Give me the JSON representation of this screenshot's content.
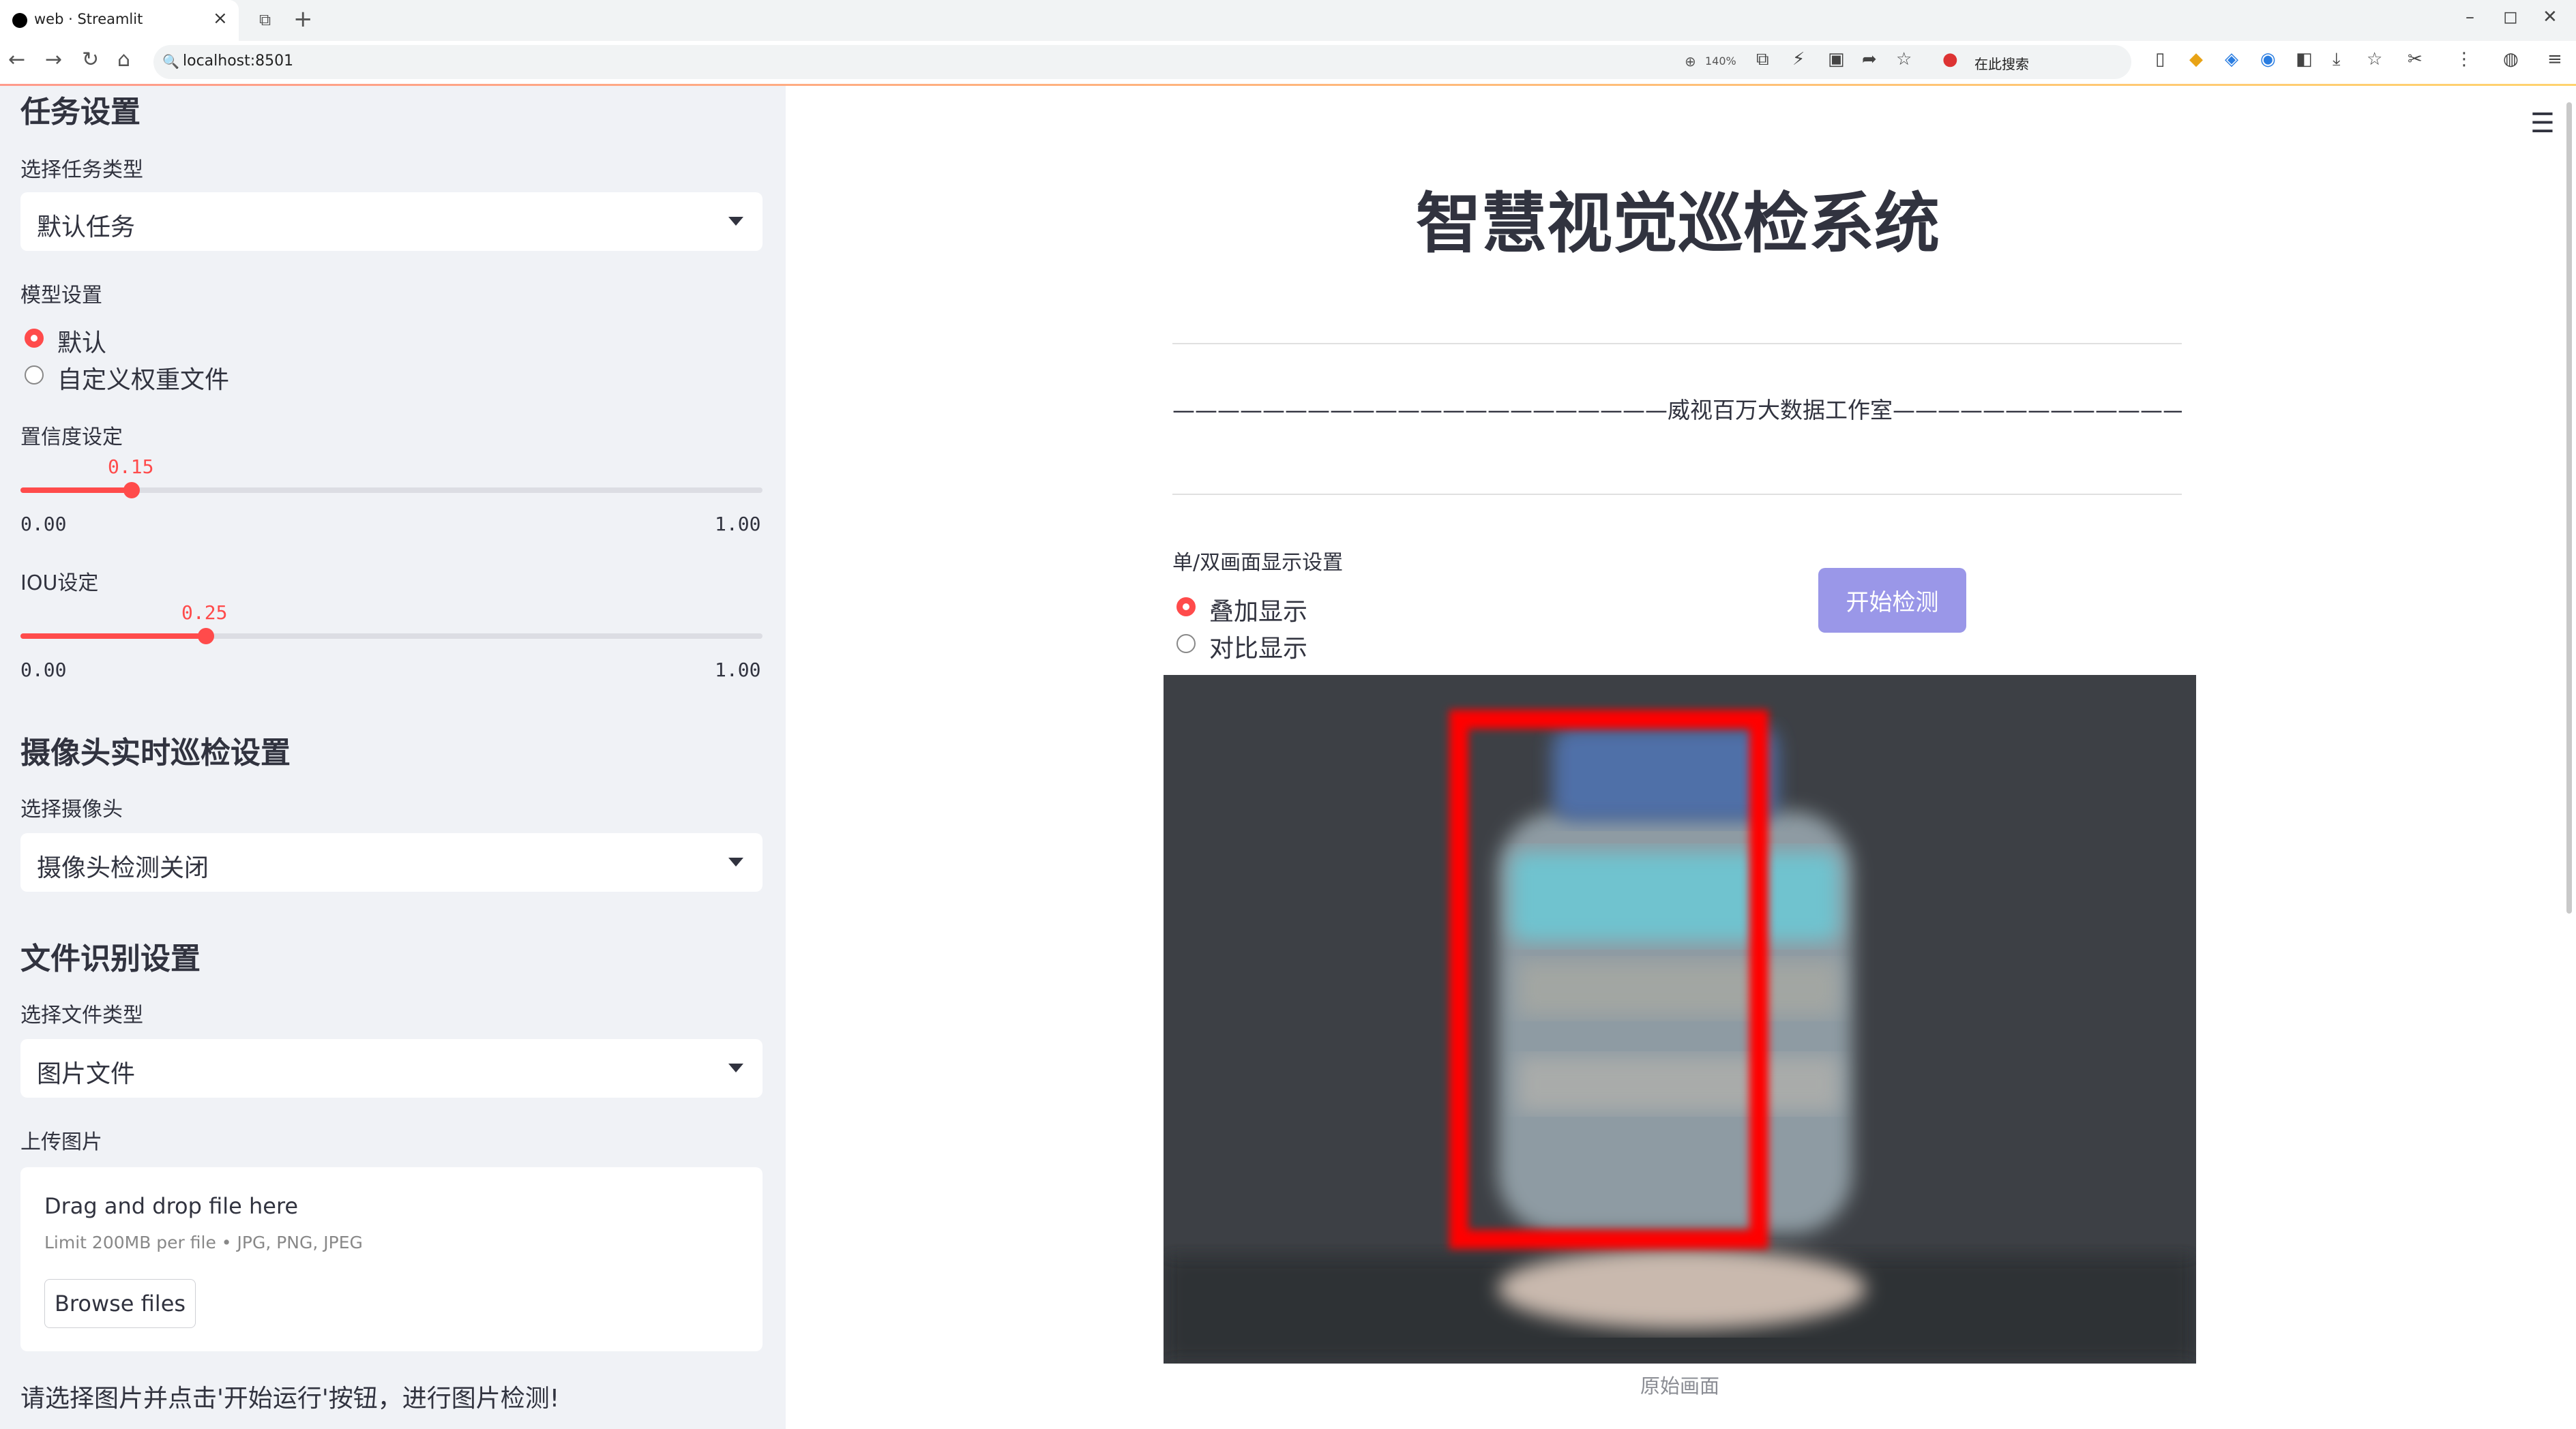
{
  "browser": {
    "tab_title": "web · Streamlit",
    "tab_close": "×",
    "new_tab": "+",
    "url": "localhost:8501",
    "zoom": "140%",
    "search_placeholder": "在此搜索",
    "window_controls": [
      "–",
      "◻",
      "✕"
    ]
  },
  "sidebar": {
    "task_section_title": "任务设置",
    "task_type_label": "选择任务类型",
    "task_type_value": "默认任务",
    "model_label": "模型设置",
    "model_options": [
      "默认",
      "自定义权重文件"
    ],
    "model_selected": 0,
    "conf_label": "置信度设定",
    "conf_value": "0.15",
    "conf_fraction": 0.15,
    "conf_min": "0.00",
    "conf_max": "1.00",
    "iou_label": "IOU设定",
    "iou_value": "0.25",
    "iou_fraction": 0.25,
    "iou_min": "0.00",
    "iou_max": "1.00",
    "camera_section_title": "摄像头实时巡检设置",
    "camera_label": "选择摄像头",
    "camera_value": "摄像头检测关闭",
    "file_section_title": "文件识别设置",
    "file_type_label": "选择文件类型",
    "file_type_value": "图片文件",
    "upload_label": "上传图片",
    "upload_drop_title": "Drag and drop file here",
    "upload_limit": "Limit 200MB per file • JPG, PNG, JPEG",
    "browse_label": "Browse files",
    "hint": "请选择图片并点击'开始运行'按钮，进行图片检测!"
  },
  "main": {
    "title": "智慧视觉巡检系统",
    "studio_line": "——————————————————————威视百万大数据工作室———————————————————————",
    "display_mode_label": "单/双画面显示设置",
    "display_options": [
      "叠加显示",
      "对比显示"
    ],
    "display_selected": 0,
    "start_button": "开始检测",
    "image_caption": "原始画面"
  },
  "colors": {
    "accent": "#ff4b4b",
    "sidebar_bg": "#f0f2f6",
    "button_bg": "#9a97e8",
    "detection_box": "#ff0000"
  }
}
